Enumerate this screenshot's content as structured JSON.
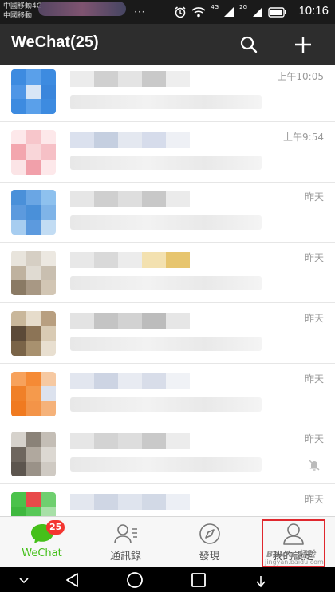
{
  "status_bar": {
    "carrier_1": "中國移動4G",
    "carrier_2": "中國移動",
    "dots": "···",
    "network_label_1": "4G",
    "network_label_2": "2G",
    "time": "10:16"
  },
  "app_bar": {
    "title": "WeChat(25)",
    "search_icon": "search-icon",
    "add_icon": "plus-icon"
  },
  "chats": [
    {
      "time": "上午10:05",
      "avatar_colors": [
        "#3d8be0",
        "#5aa0ea",
        "#3d8be0",
        "#4f96e6",
        "#d8e6f6",
        "#3a86dc",
        "#3d8be0",
        "#5aa0ea",
        "#3d8be0"
      ],
      "name_colors": [
        "#ececec",
        "#d0d0d0",
        "#e4e4e4",
        "#c9c9c9",
        "#eeeeee"
      ],
      "muted": false
    },
    {
      "time": "上午9:54",
      "avatar_colors": [
        "#fde8ea",
        "#f7c6cb",
        "#fde8ea",
        "#f3a6ae",
        "#f9d6d9",
        "#f6c0c6",
        "#fbe4e6",
        "#f1a0aa",
        "#fde8ea"
      ],
      "name_colors": [
        "#dbe1ee",
        "#c5cfe0",
        "#e4e8f0",
        "#d6dceb",
        "#eef0f5"
      ],
      "muted": false
    },
    {
      "time": "昨天",
      "avatar_colors": [
        "#4a90d9",
        "#6aa6e4",
        "#8ec1ee",
        "#5c9ade",
        "#4a90d9",
        "#7fb4e8",
        "#a7cdf0",
        "#5c9ade",
        "#c2dcf3"
      ],
      "name_colors": [
        "#e6e6e6",
        "#cfcfcf",
        "#dedede",
        "#c8c8c8",
        "#ebebeb"
      ],
      "muted": false
    },
    {
      "time": "昨天",
      "avatar_colors": [
        "#e8e4dc",
        "#d6cfc4",
        "#ece8e1",
        "#bfb29f",
        "#e0dbd2",
        "#c9bfb0",
        "#8a7a64",
        "#a89884",
        "#d2c6b4"
      ],
      "name_colors": [
        "#e8e8e8",
        "#d9d9d9",
        "#ececec",
        "#f3e1b0",
        "#e7c56e"
      ],
      "muted": false
    },
    {
      "time": "昨天",
      "avatar_colors": [
        "#c9b79b",
        "#e6dccb",
        "#b89f80",
        "#5c4a38",
        "#8c7456",
        "#d9cbb4",
        "#7a6448",
        "#a8916f",
        "#e8dfd0"
      ],
      "name_colors": [
        "#e3e3e3",
        "#c4c4c4",
        "#d2d2d2",
        "#bcbcbc",
        "#e6e6e6"
      ],
      "muted": false
    },
    {
      "time": "昨天",
      "avatar_colors": [
        "#f7a25c",
        "#f58a35",
        "#f6c9a2",
        "#f08028",
        "#f59a4c",
        "#dce2ee",
        "#f07a20",
        "#f39448",
        "#f5b27a"
      ],
      "name_colors": [
        "#e2e6ef",
        "#cdd4e3",
        "#e8ebf2",
        "#d8dde9",
        "#f0f2f6"
      ],
      "muted": false
    },
    {
      "time": "昨天",
      "avatar_colors": [
        "#d6d2cc",
        "#8a8278",
        "#c4beb6",
        "#6e665e",
        "#b0a89e",
        "#dcd8d2",
        "#5c554e",
        "#9a9288",
        "#cfcac3"
      ],
      "name_colors": [
        "#e6e6e6",
        "#d3d3d3",
        "#dddddd",
        "#c9c9c9",
        "#ececec"
      ],
      "muted": true
    },
    {
      "time": "昨天",
      "avatar_colors": [
        "#4bc24b",
        "#e84a4a",
        "#6fcf6f",
        "#3fb83f",
        "#58c858",
        "#a8e0a8",
        "#4bc24b",
        "#7bd27b",
        "#c8ecc8"
      ],
      "name_colors": [
        "#e3e7ef",
        "#cfd6e4",
        "#dfe4ee",
        "#d2d9e6",
        "#eceff5"
      ],
      "muted": false
    }
  ],
  "bottom_nav": [
    {
      "label": "WeChat",
      "icon": "chat-bubble-icon",
      "active": true,
      "badge": "25"
    },
    {
      "label": "通訊錄",
      "icon": "contacts-icon",
      "active": false
    },
    {
      "label": "發現",
      "icon": "compass-icon",
      "active": false
    },
    {
      "label": "我的設定",
      "icon": "person-icon",
      "active": false
    }
  ],
  "watermark": {
    "brand": "Baidu 经验",
    "url": "jingyan.baidu.com"
  },
  "system_nav": {
    "back_icon": "back-triangle-icon",
    "home_icon": "home-circle-icon",
    "recents_icon": "recents-square-icon",
    "collapse_icon": "chevron-down-icon",
    "download_icon": "download-arrow-icon"
  },
  "colors": {
    "app_bar": "#2d2d2d",
    "accent_green": "#45c01a",
    "badge_red": "#f43530",
    "highlight_red": "#e0282e"
  }
}
